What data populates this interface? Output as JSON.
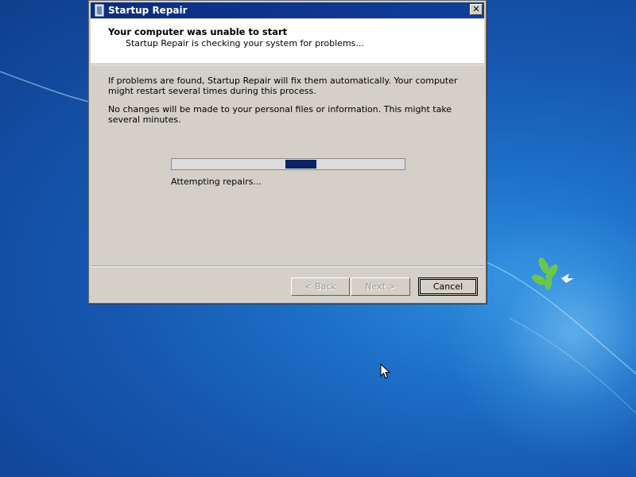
{
  "colors": {
    "desktop_blue": "#1657b0",
    "titlebar": "#0b2c82",
    "dialog_face": "#d4d0c8",
    "progress_chunk": "#0c2263"
  },
  "window": {
    "title": "Startup Repair",
    "icon": "startup-repair-icon",
    "close_glyph": "✕"
  },
  "header": {
    "heading": "Your computer was unable to start",
    "subheading": "Startup Repair is checking your system for problems..."
  },
  "body": {
    "paragraph1": "If problems are found, Startup Repair will fix them automatically. Your computer might restart several times during this process.",
    "paragraph2": "No changes will be made to your personal files or information. This might take several minutes."
  },
  "progress": {
    "mode": "marquee",
    "status": "Attempting repairs..."
  },
  "buttons": {
    "back": "< Back",
    "next": "Next >",
    "cancel": "Cancel"
  }
}
